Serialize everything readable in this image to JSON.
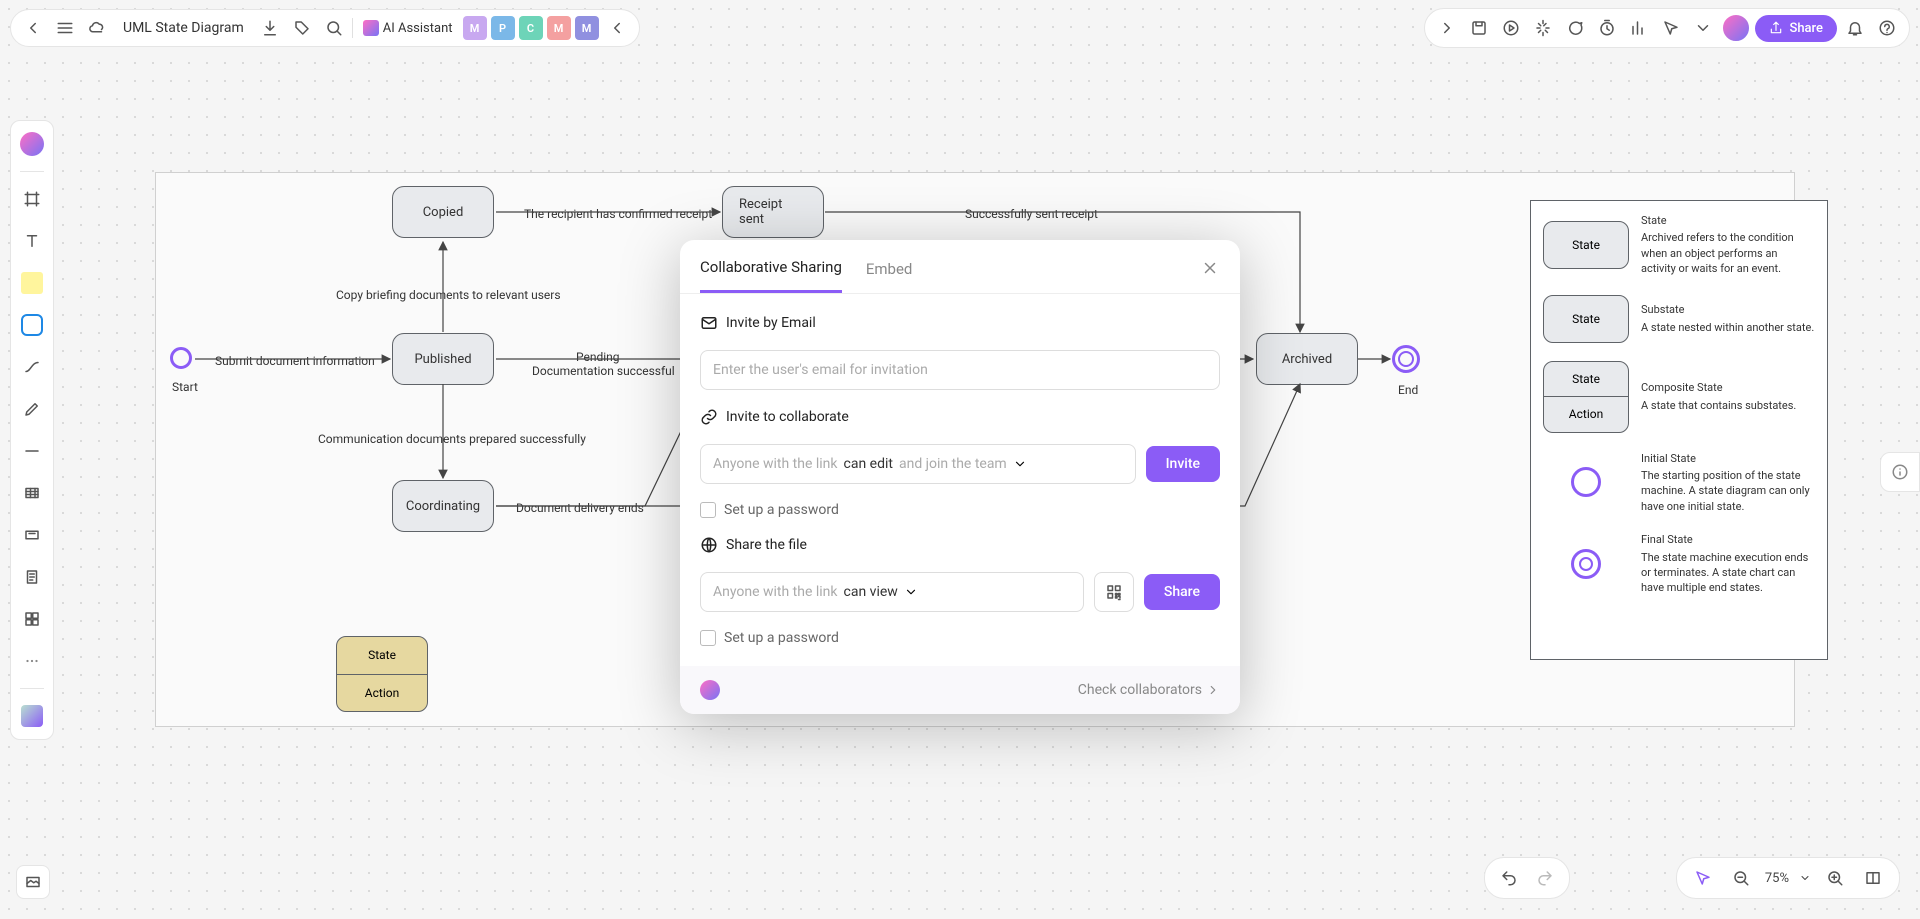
{
  "header": {
    "doc_title": "UML State Diagram",
    "ai_label": "AI Assistant",
    "share_label": "Share",
    "personas": [
      "M",
      "P",
      "C",
      "M",
      "M"
    ]
  },
  "diagram": {
    "start_label": "Start",
    "end_label": "End",
    "nodes": {
      "copied": "Copied",
      "receipt_sent": "Receipt sent",
      "published": "Published",
      "archived": "Archived",
      "coordinating": "Coordinating"
    },
    "edges": {
      "copied_published": "Copy briefing documents to relevant users",
      "copied_receipt": "The recipient has confirmed receipt",
      "receipt_archived": "Successfully sent receipt",
      "start_published": "Submit document information",
      "published_receipt_l1": "Pending",
      "published_receipt_l2": "Documentation successful",
      "published_coord": "Communication documents prepared successfully",
      "coord_archived": "Document delivery ends"
    },
    "free_node": {
      "top": "State",
      "bottom": "Action"
    }
  },
  "legend": {
    "state": {
      "title": "State",
      "box": "State",
      "desc": "Archived refers to the condition when an object performs an activity or waits for an event."
    },
    "substate": {
      "title": "Substate",
      "box": "State",
      "desc": "A state nested within another state."
    },
    "composite": {
      "title": "Composite State",
      "top": "State",
      "bottom": "Action",
      "desc": "A state that contains substates."
    },
    "initial": {
      "title": "Initial State",
      "desc": "The starting position of the state machine. A state diagram can only have one initial state."
    },
    "final": {
      "title": "Final State",
      "desc": "The state machine execution ends or terminates. A state chart can have multiple end states."
    }
  },
  "modal": {
    "tab_share": "Collaborative Sharing",
    "tab_embed": "Embed",
    "invite_email_label": "Invite by Email",
    "email_placeholder": "Enter the user's email for invitation",
    "invite_collab_label": "Invite to collaborate",
    "anyone_link_1": "Anyone with the link",
    "can_edit": "can edit",
    "join_team": "and join the team",
    "invite_btn": "Invite",
    "setup_password": "Set up a password",
    "share_file_label": "Share the file",
    "anyone_link_2": "Anyone with the link",
    "can_view": "can view",
    "share_btn": "Share",
    "check_collab": "Check collaborators"
  },
  "bottom": {
    "zoom_label": "75%"
  }
}
